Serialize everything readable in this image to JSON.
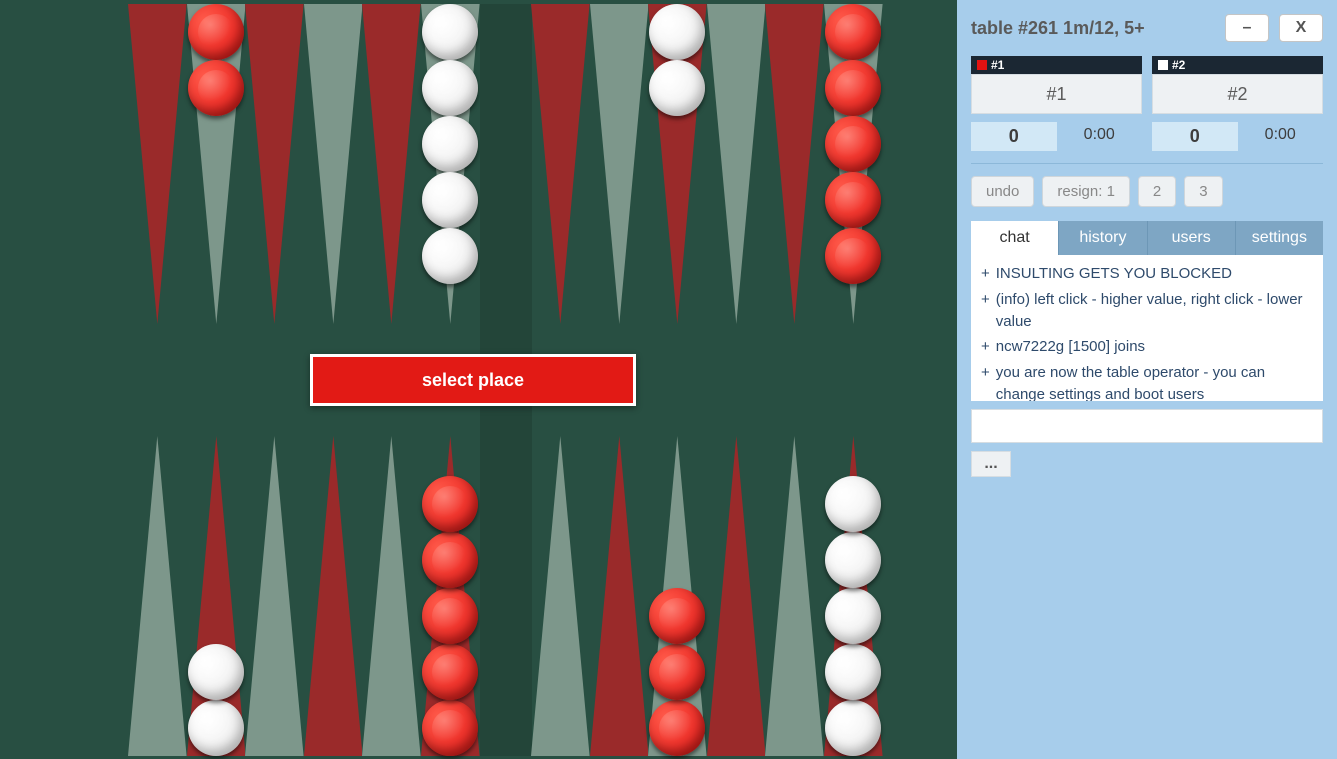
{
  "header": {
    "title": "table #261   1m/12, 5+",
    "minimize_label": "–",
    "close_label": "X"
  },
  "players": [
    {
      "slot_tag": "#1",
      "name": "#1",
      "color": "red",
      "score": "0",
      "time": "0:00"
    },
    {
      "slot_tag": "#2",
      "name": "#2",
      "color": "white",
      "score": "0",
      "time": "0:00"
    }
  ],
  "actions": {
    "undo": "undo",
    "resign": "resign: 1",
    "resign_2": "2",
    "resign_3": "3"
  },
  "tabs": {
    "chat": "chat",
    "history": "history",
    "users": "users",
    "settings": "settings",
    "active": "chat"
  },
  "chat": {
    "messages": [
      "INSULTING GETS YOU BLOCKED",
      "(info) left click - higher value, right click - lower value",
      "ncw7222g [1500] joins",
      "you are now the table operator - you can change settings and boot users"
    ],
    "input_value": "",
    "more_label": "..."
  },
  "board": {
    "prompt": "select place",
    "point_colors": {
      "dark": "#9a2a2a",
      "light": "#7d978b"
    },
    "checker_colors": {
      "red": "#e31212",
      "white": "#f0f0f0"
    },
    "points_top": [
      {
        "idx": 13,
        "half": "left",
        "col": 0,
        "color": "dark",
        "checkers": ""
      },
      {
        "idx": 14,
        "half": "left",
        "col": 1,
        "color": "light",
        "checkers": "rr"
      },
      {
        "idx": 15,
        "half": "left",
        "col": 2,
        "color": "dark",
        "checkers": ""
      },
      {
        "idx": 16,
        "half": "left",
        "col": 3,
        "color": "light",
        "checkers": ""
      },
      {
        "idx": 17,
        "half": "left",
        "col": 4,
        "color": "dark",
        "checkers": ""
      },
      {
        "idx": 18,
        "half": "left",
        "col": 5,
        "color": "light",
        "checkers": "wwwww"
      },
      {
        "idx": 19,
        "half": "right",
        "col": 0,
        "color": "dark",
        "checkers": ""
      },
      {
        "idx": 20,
        "half": "right",
        "col": 1,
        "color": "light",
        "checkers": ""
      },
      {
        "idx": 21,
        "half": "right",
        "col": 2,
        "color": "dark",
        "checkers": "ww"
      },
      {
        "idx": 22,
        "half": "right",
        "col": 3,
        "color": "light",
        "checkers": ""
      },
      {
        "idx": 23,
        "half": "right",
        "col": 4,
        "color": "dark",
        "checkers": ""
      },
      {
        "idx": 24,
        "half": "right",
        "col": 5,
        "color": "light",
        "checkers": "rrrrr"
      }
    ],
    "points_bottom": [
      {
        "idx": 12,
        "half": "left",
        "col": 0,
        "color": "light",
        "checkers": ""
      },
      {
        "idx": 11,
        "half": "left",
        "col": 1,
        "color": "dark",
        "checkers": "ww"
      },
      {
        "idx": 10,
        "half": "left",
        "col": 2,
        "color": "light",
        "checkers": ""
      },
      {
        "idx": 9,
        "half": "left",
        "col": 3,
        "color": "dark",
        "checkers": ""
      },
      {
        "idx": 8,
        "half": "left",
        "col": 4,
        "color": "light",
        "checkers": ""
      },
      {
        "idx": 7,
        "half": "left",
        "col": 5,
        "color": "dark",
        "checkers": "rrrrr"
      },
      {
        "idx": 6,
        "half": "right",
        "col": 0,
        "color": "light",
        "checkers": ""
      },
      {
        "idx": 5,
        "half": "right",
        "col": 1,
        "color": "dark",
        "checkers": ""
      },
      {
        "idx": 4,
        "half": "right",
        "col": 2,
        "color": "light",
        "checkers": "rrr"
      },
      {
        "idx": 3,
        "half": "right",
        "col": 3,
        "color": "dark",
        "checkers": ""
      },
      {
        "idx": 2,
        "half": "right",
        "col": 4,
        "color": "light",
        "checkers": ""
      },
      {
        "idx": 1,
        "half": "right",
        "col": 5,
        "color": "dark",
        "checkers": "wwwww"
      }
    ]
  }
}
